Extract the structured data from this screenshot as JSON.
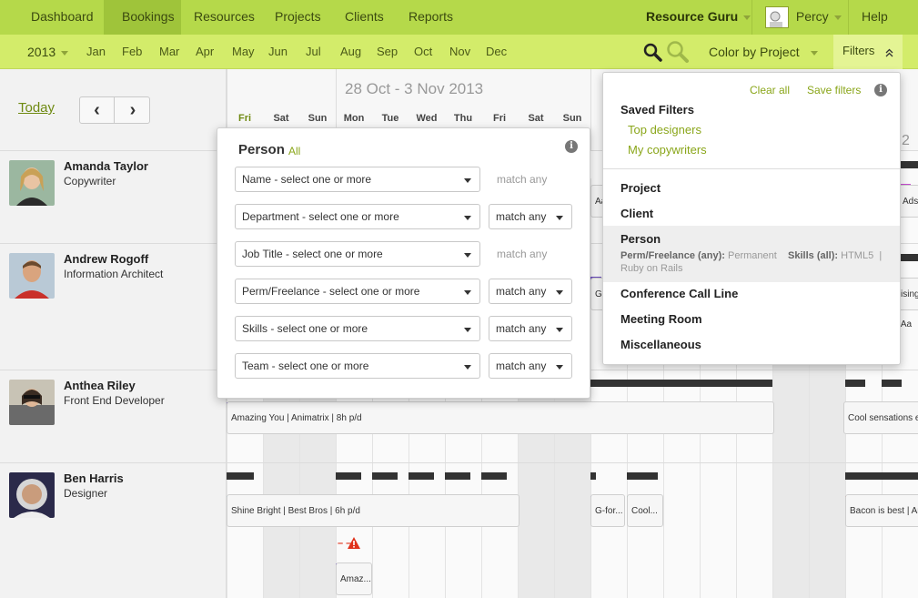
{
  "top_nav": {
    "items": [
      "Dashboard",
      "Bookings",
      "Resources",
      "Projects",
      "Clients",
      "Reports"
    ],
    "active": "Bookings",
    "account": "Resource Guru",
    "user": "Percy",
    "help": "Help"
  },
  "sub_nav": {
    "year": "2013",
    "months": [
      "Jan",
      "Feb",
      "Mar",
      "Apr",
      "May",
      "Jun",
      "Jul",
      "Aug",
      "Sep",
      "Oct",
      "Nov",
      "Dec"
    ],
    "color_by": "Color by Project",
    "filters": "Filters",
    "icons": [
      "zoom-in-icon",
      "zoom-out-icon",
      "collapse-icon"
    ]
  },
  "toolbar": {
    "today": "Today",
    "prev": "‹",
    "next": "›"
  },
  "calendar": {
    "date_range": "28 Oct - 3 Nov 2013",
    "day_headers": [
      "Fri",
      "Sat",
      "Sun",
      "Mon",
      "Tue",
      "Wed",
      "Thu",
      "Fri",
      "Sat",
      "Sun"
    ],
    "next_week_day_number": "2"
  },
  "resources": [
    {
      "name": "Amanda Taylor",
      "role": "Copywriter"
    },
    {
      "name": "Andrew Rogoff",
      "role": "Information Architect"
    },
    {
      "name": "Anthea Riley",
      "role": "Front End Developer"
    },
    {
      "name": "Ben Harris",
      "role": "Designer"
    }
  ],
  "bookings": {
    "amazing_you": "Amazing You | Animatrix | 8h p/d",
    "cool_sensations": "Cool sensations en",
    "shine_bright": "Shine Bright | Best Bros | 6h p/d",
    "g_for": "G-for...",
    "cool": "Cool...",
    "bacon": "Bacon is best | Ard",
    "amaz": "Amaz...",
    "overbook_mark": "–   –",
    "edge_aa": "Aa",
    "edge_ads": "Ads",
    "edge_g": "G-",
    "edge_ising": "ising",
    "edge_aa2": "| Aa"
  },
  "person_filter": {
    "title": "Person",
    "all_link": "All",
    "rows": [
      {
        "placeholder": "Name - select one or more",
        "match": "match any",
        "dropdown": false
      },
      {
        "placeholder": "Department - select one or more",
        "match": "match any",
        "dropdown": true
      },
      {
        "placeholder": "Job Title - select one or more",
        "match": "match any",
        "dropdown": false
      },
      {
        "placeholder": "Perm/Freelance - select one or more",
        "match": "match any",
        "dropdown": true
      },
      {
        "placeholder": "Skills - select one or more",
        "match": "match any",
        "dropdown": true
      },
      {
        "placeholder": "Team - select one or more",
        "match": "match any",
        "dropdown": true
      }
    ]
  },
  "filters_dropdown": {
    "clear_all": "Clear all",
    "save_filters": "Save filters",
    "saved_filters_title": "Saved Filters",
    "saved_filters": [
      "Top designers",
      "My copywriters"
    ],
    "categories": [
      "Project",
      "Client",
      "Person",
      "Conference Call Line",
      "Meeting Room",
      "Miscellaneous"
    ],
    "person_detail": {
      "perm_label": "Perm/Freelance (any):",
      "perm_value": "Permanent",
      "skills_label": "Skills (all):",
      "skills_value": "HTML5",
      "sep": "|",
      "skills_value_2": "Ruby on Rails"
    }
  },
  "colors": {
    "nav_green": "#b5d94a",
    "subnav_green": "#d3ec6a",
    "link_green": "#8aa61a",
    "purple": "#6b4bbf",
    "blue": "#3daee9",
    "green": "#2ec27e",
    "red": "#e0321b",
    "magenta": "#c64bd1"
  }
}
